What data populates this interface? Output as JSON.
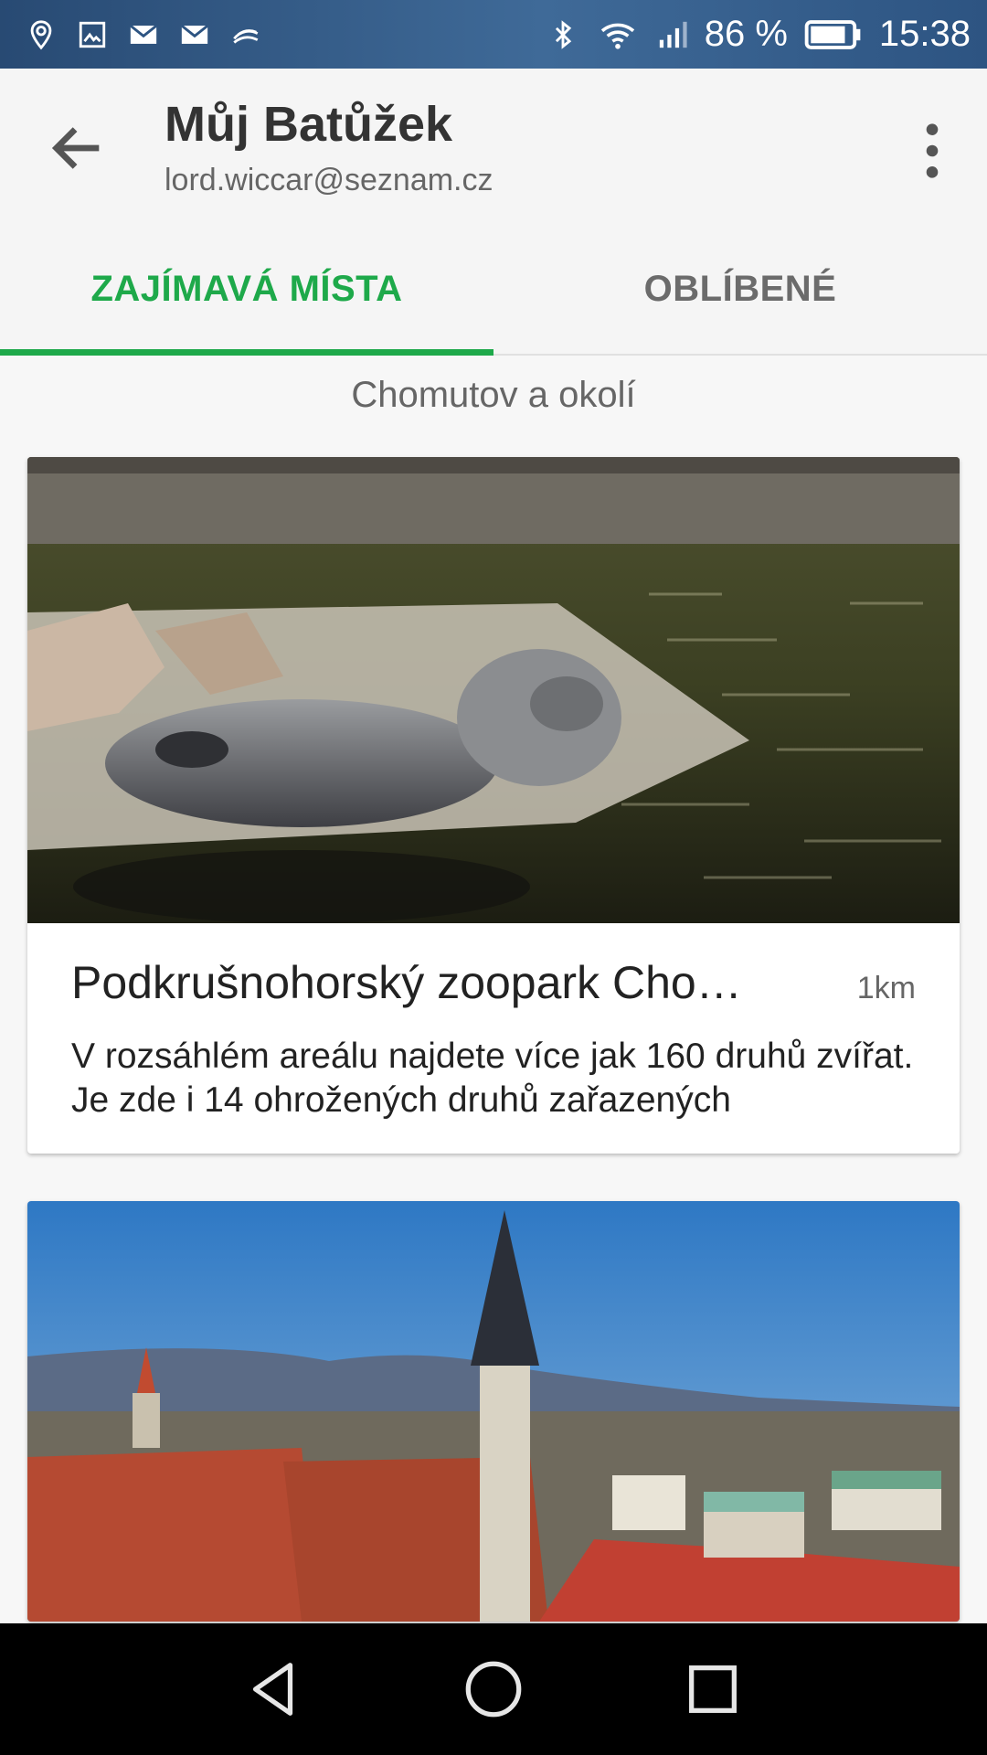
{
  "status_bar": {
    "left_icons": [
      "location-icon",
      "image-icon",
      "gmail-icon",
      "gmail-icon",
      "swiftkey-icon"
    ],
    "battery_percent": "86 %",
    "time": "15:38",
    "battery_level": 0.86
  },
  "app_bar": {
    "title": "Můj Batůžek",
    "subtitle": "lord.wiccar@seznam.cz"
  },
  "tabs": [
    {
      "label": "ZAJÍMAVÁ MÍSTA",
      "active": true
    },
    {
      "label": "OBLÍBENÉ",
      "active": false
    }
  ],
  "section_title": "Chomutov a okolí",
  "cards": [
    {
      "title": "Podkrušnohorský zoopark Cho…",
      "distance": "1km",
      "description": "V rozsáhlém areálu najdete více jak  160 druhů zvířat. Je zde i 14 ohrožených druhů zařazených"
    },
    {
      "title": "",
      "distance": "",
      "description": ""
    }
  ],
  "colors": {
    "accent": "#1ea94a",
    "status_bar": "#2d5482"
  }
}
